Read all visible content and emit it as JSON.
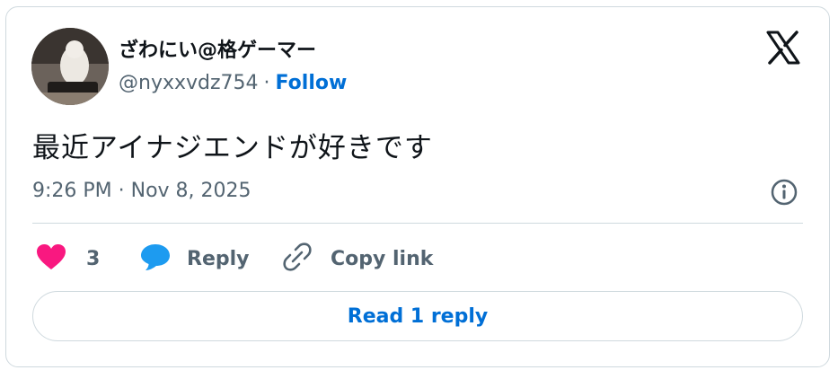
{
  "author": {
    "name": "ざわにい@格ゲーマー",
    "handle": "@nyxxvdz754",
    "separator": "·",
    "follow_label": "Follow"
  },
  "tweet": {
    "text": "最近アイナジエンドが好きです",
    "timestamp": "9:26 PM · Nov 8, 2025"
  },
  "actions": {
    "like_count": "3",
    "reply_label": "Reply",
    "copy_link_label": "Copy link"
  },
  "footer": {
    "read_replies_label": "Read 1 reply"
  },
  "icons": {
    "logo": "x-logo-icon",
    "info": "info-icon",
    "like": "heart-icon",
    "reply": "speech-bubble-icon",
    "copy": "link-icon"
  },
  "colors": {
    "like": "#f91880",
    "reply": "#1d9bf0",
    "link": "#006fd6",
    "secondary_text": "#536471",
    "border": "#cfd9de"
  }
}
